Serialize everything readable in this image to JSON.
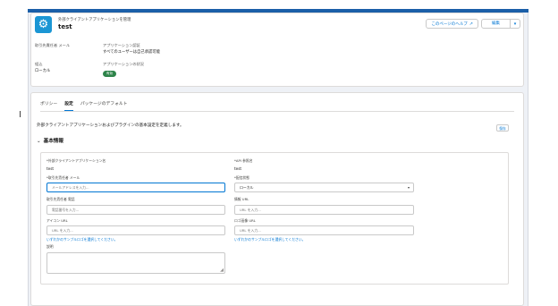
{
  "header": {
    "object_label": "外部クライアントアプリケーションを管理",
    "record_name": "test",
    "help_button": "このページのヘルプ",
    "edit_button": "編集",
    "fields": [
      {
        "label": "取引先責任者 メール",
        "value": ""
      },
      {
        "label": "アプリケーション認証",
        "value": "すべてのユーザーは自己承認可能"
      },
      {
        "label": "組込",
        "value": "ローカル"
      },
      {
        "label": "アプリケーションの状況",
        "value": "有効"
      }
    ]
  },
  "tabs": [
    {
      "label": "ポリシー",
      "active": false
    },
    {
      "label": "設定",
      "active": true
    },
    {
      "label": "パッケージのデフォルト",
      "active": false
    }
  ],
  "intro_text": "外部クライアントアプリケーションおよびプラグインの基本設定を定義します。",
  "save_button": "保存",
  "section": {
    "title": "基本情報",
    "left": {
      "app_name_label": "*外部クライアントアプリケーション名",
      "app_name_value": "test",
      "contact_email_label": "*取引先責任者 メール",
      "contact_email_placeholder": "メールアドレスを入力...",
      "contact_phone_label": "取引先責任者 電話",
      "contact_phone_placeholder": "電話番号を入力...",
      "icon_url_label": "アイコン URL",
      "icon_url_placeholder": "URL を入力...",
      "icon_sample_link": "いずれかのサンプルロゴを選択してください。",
      "description_label": "説明"
    },
    "right": {
      "api_name_label": "*API 参照名",
      "api_name_value": "test",
      "distribution_label": "*配信状態",
      "distribution_value": "ローカル",
      "info_url_label": "情報 URL",
      "info_url_placeholder": "URL を入力...",
      "logo_url_label": "ロゴ画像 URL",
      "logo_url_placeholder": "URL を入力...",
      "logo_sample_link": "いずれかのサンプルロゴを選択してください。"
    }
  },
  "icons": {
    "object_icon": "gear-icon",
    "external_link_icon": "external-link-icon",
    "dropdown_icon": "chevron-down-icon",
    "section_toggle_icon": "chevron-down-icon"
  },
  "colors": {
    "brand": "#1b96d4",
    "accent": "#0176d3",
    "status_active": "#2e844a"
  }
}
